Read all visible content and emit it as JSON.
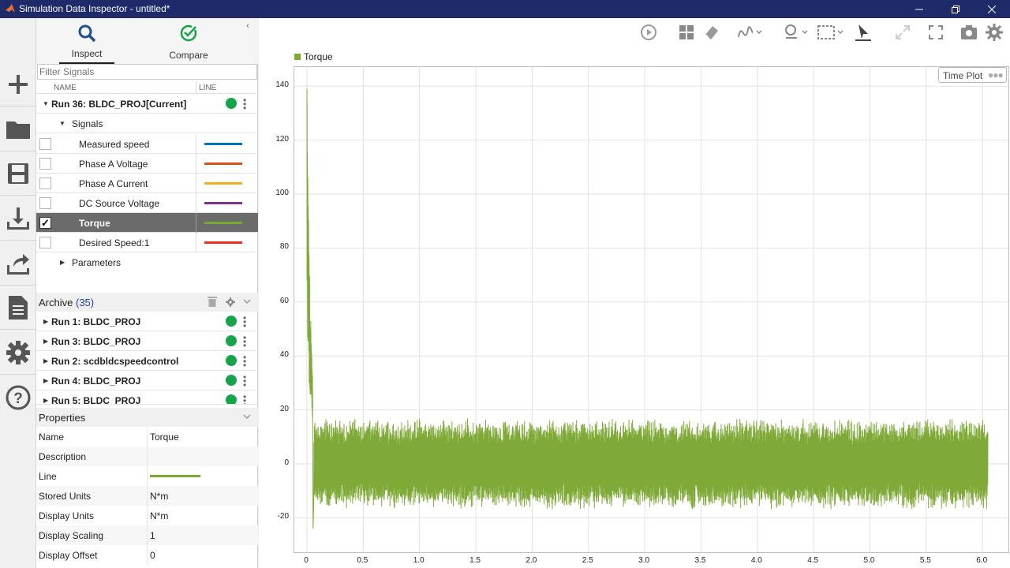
{
  "window": {
    "title": "Simulation Data Inspector - untitled*",
    "controls": [
      "minimize",
      "restore",
      "close"
    ]
  },
  "colors": {
    "titlebar": "#1f2a6b",
    "selected_row": "#6b6b6b",
    "run_status": "#17a34a",
    "torque": "#7faa37"
  },
  "leftbar": {
    "buttons": [
      "new-icon",
      "open-folder-icon",
      "save-icon",
      "import-icon",
      "export-icon",
      "report-icon",
      "settings-icon",
      "help-icon"
    ]
  },
  "tabs": [
    {
      "label": "Inspect",
      "icon": "magnifier-icon",
      "active": true
    },
    {
      "label": "Compare",
      "icon": "check-circle-icon",
      "active": false
    }
  ],
  "filter": {
    "placeholder": "Filter Signals"
  },
  "columns": {
    "name": "NAME",
    "line": "LINE"
  },
  "current_run": {
    "label": "Run 36: BLDC_PROJ[Current]",
    "signals_group": "Signals",
    "parameters_group": "Parameters",
    "signals": [
      {
        "name": "Measured speed",
        "color": "#0072bd",
        "checked": false
      },
      {
        "name": "Phase A Voltage",
        "color": "#d95319",
        "checked": false
      },
      {
        "name": "Phase A Current",
        "color": "#edb120",
        "checked": false
      },
      {
        "name": "DC Source Voltage",
        "color": "#7e2f8e",
        "checked": false
      },
      {
        "name": "Torque",
        "color": "#77ac30",
        "checked": true
      },
      {
        "name": "Desired Speed:1",
        "color": "#e8321c",
        "checked": false
      }
    ]
  },
  "archive": {
    "label": "Archive",
    "count": "(35)",
    "runs": [
      "Run 1: BLDC_PROJ",
      "Run 3: BLDC_PROJ",
      "Run 2: scdbldcspeedcontrol",
      "Run 4: BLDC_PROJ",
      "Run 5: BLDC_PROJ"
    ]
  },
  "properties": {
    "label": "Properties",
    "rows": [
      {
        "key": "Name",
        "value": "Torque"
      },
      {
        "key": "Description",
        "value": ""
      },
      {
        "key": "Line",
        "value": ""
      },
      {
        "key": "Stored Units",
        "value": "N*m"
      },
      {
        "key": "Display Units",
        "value": "N*m"
      },
      {
        "key": "Display Scaling",
        "value": "1"
      },
      {
        "key": "Display Offset",
        "value": "0"
      }
    ]
  },
  "plot": {
    "legend": "Torque",
    "layout_button": "Time Plot"
  },
  "chart_data": {
    "type": "line",
    "series": [
      {
        "name": "Torque",
        "color": "#7faa37"
      }
    ],
    "title": "",
    "xlabel": "",
    "ylabel": "",
    "xlim": [
      0,
      6.1
    ],
    "ylim": [
      -26,
      150
    ],
    "xticks": [
      "0",
      "0.5",
      "1.0",
      "1.5",
      "2.0",
      "2.5",
      "3.0",
      "3.5",
      "4.0",
      "4.5",
      "5.0",
      "5.5",
      "6.0"
    ],
    "yticks": [
      "-20",
      "0",
      "20",
      "40",
      "60",
      "80",
      "100",
      "120",
      "140"
    ],
    "grid": true,
    "legend_position": "top-left",
    "features": {
      "initial_peak": 139,
      "transient_end_x": 0.05,
      "steady_band_min": -15,
      "steady_band_max": 15,
      "min_value": -24
    }
  }
}
